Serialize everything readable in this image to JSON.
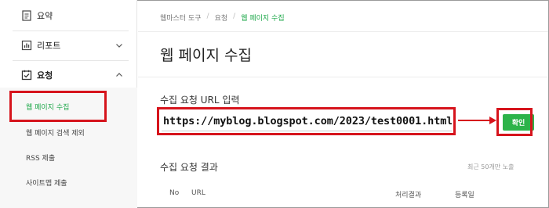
{
  "sidebar": {
    "items": [
      {
        "label": "요약",
        "icon": "document-icon"
      },
      {
        "label": "리포트",
        "icon": "bar-chart-icon",
        "expanded": false
      },
      {
        "label": "요청",
        "icon": "checkbox-icon",
        "expanded": true
      }
    ],
    "subitems": [
      {
        "label": "웹 페이지 수집",
        "active": true
      },
      {
        "label": "웹 페이지 검색 제외",
        "active": false
      },
      {
        "label": "RSS 제출",
        "active": false
      },
      {
        "label": "사이트맵 제출",
        "active": false
      }
    ]
  },
  "breadcrumb": [
    "웹마스터 도구",
    "요청",
    "웹 페이지 수집"
  ],
  "page_title": "웹 페이지 수집",
  "form": {
    "label": "수집 요청 URL 입력",
    "url_value": "https://myblog.blogspot.com/2023/test0001.html",
    "confirm_label": "확인"
  },
  "results": {
    "title": "수집 요청 결과",
    "note": "최근 50개만 노출",
    "columns": [
      "No",
      "URL",
      "처리결과",
      "등록일"
    ]
  },
  "colors": {
    "accent_green": "#2db34a",
    "highlight_red": "#d6141c"
  }
}
